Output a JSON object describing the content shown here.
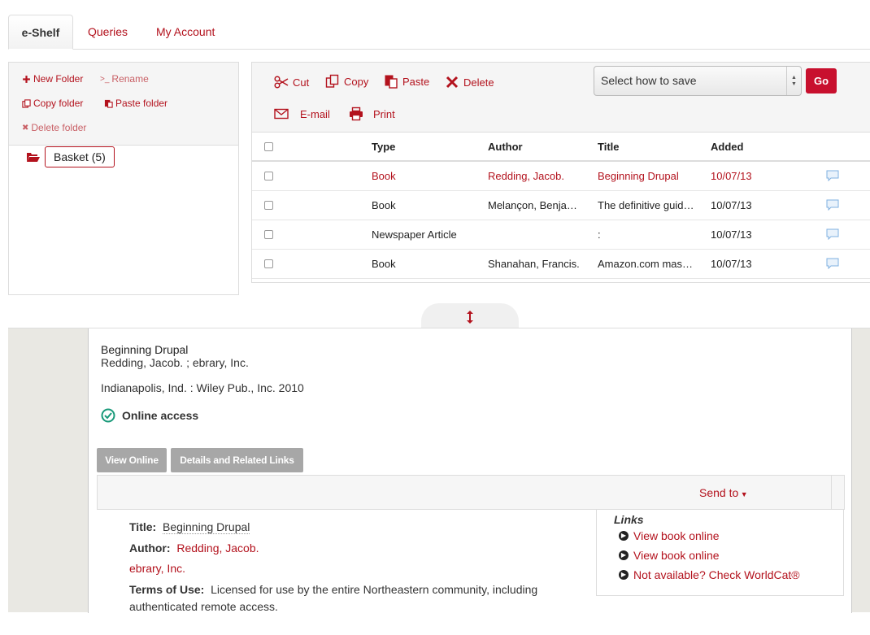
{
  "tabs": [
    {
      "label": "e-Shelf",
      "active": true
    },
    {
      "label": "Queries",
      "active": false
    },
    {
      "label": "My Account",
      "active": false
    }
  ],
  "folder_tools": {
    "new_folder": "New Folder",
    "rename": "Rename",
    "copy_folder": "Copy folder",
    "paste_folder": "Paste folder",
    "delete_folder": "Delete folder"
  },
  "basket": {
    "label": "Basket (5)"
  },
  "toolbar": {
    "cut": "Cut",
    "copy": "Copy",
    "paste": "Paste",
    "delete": "Delete",
    "email": "E-mail",
    "print": "Print",
    "save_select": "Select how to save",
    "go": "Go"
  },
  "table": {
    "headers": {
      "type": "Type",
      "author": "Author",
      "title": "Title",
      "added": "Added"
    },
    "rows": [
      {
        "type": "Book",
        "author": "Redding, Jacob.",
        "title": "Beginning Drupal",
        "added": "10/07/13",
        "highlight": true
      },
      {
        "type": "Book",
        "author": "Melançon, Benja…",
        "title": "The definitive guid…",
        "added": "10/07/13",
        "highlight": false
      },
      {
        "type": "Newspaper Article",
        "author": "",
        "title": ":",
        "added": "10/07/13",
        "highlight": false
      },
      {
        "type": "Book",
        "author": "Shanahan, Francis.",
        "title": "Amazon.com mas…",
        "added": "10/07/13",
        "highlight": false
      }
    ]
  },
  "detail": {
    "title": "Beginning Drupal",
    "author_line": "Redding, Jacob. ; ebrary, Inc.",
    "publisher": "Indianapolis, Ind. : Wiley Pub., Inc. 2010",
    "availability": "Online access",
    "buttons": {
      "view_online": "View Online",
      "details": "Details and Related Links"
    },
    "send_to": "Send to",
    "fields": {
      "title_label": "Title:",
      "title_value": "Beginning Drupal",
      "author_label": "Author:",
      "author_value": "Redding, Jacob.",
      "author_value2": "ebrary, Inc.",
      "terms_label": "Terms of Use:",
      "terms_value": "Licensed for use by the entire Northeastern community, including",
      "terms_value2": "authenticated remote access."
    },
    "links": {
      "title": "Links",
      "items": [
        "View book online",
        "View book online",
        "Not available? Check WorldCat®"
      ]
    }
  },
  "colors": {
    "accent": "#b3121d",
    "go_button": "#c8102e",
    "success": "#1a9a7a"
  }
}
